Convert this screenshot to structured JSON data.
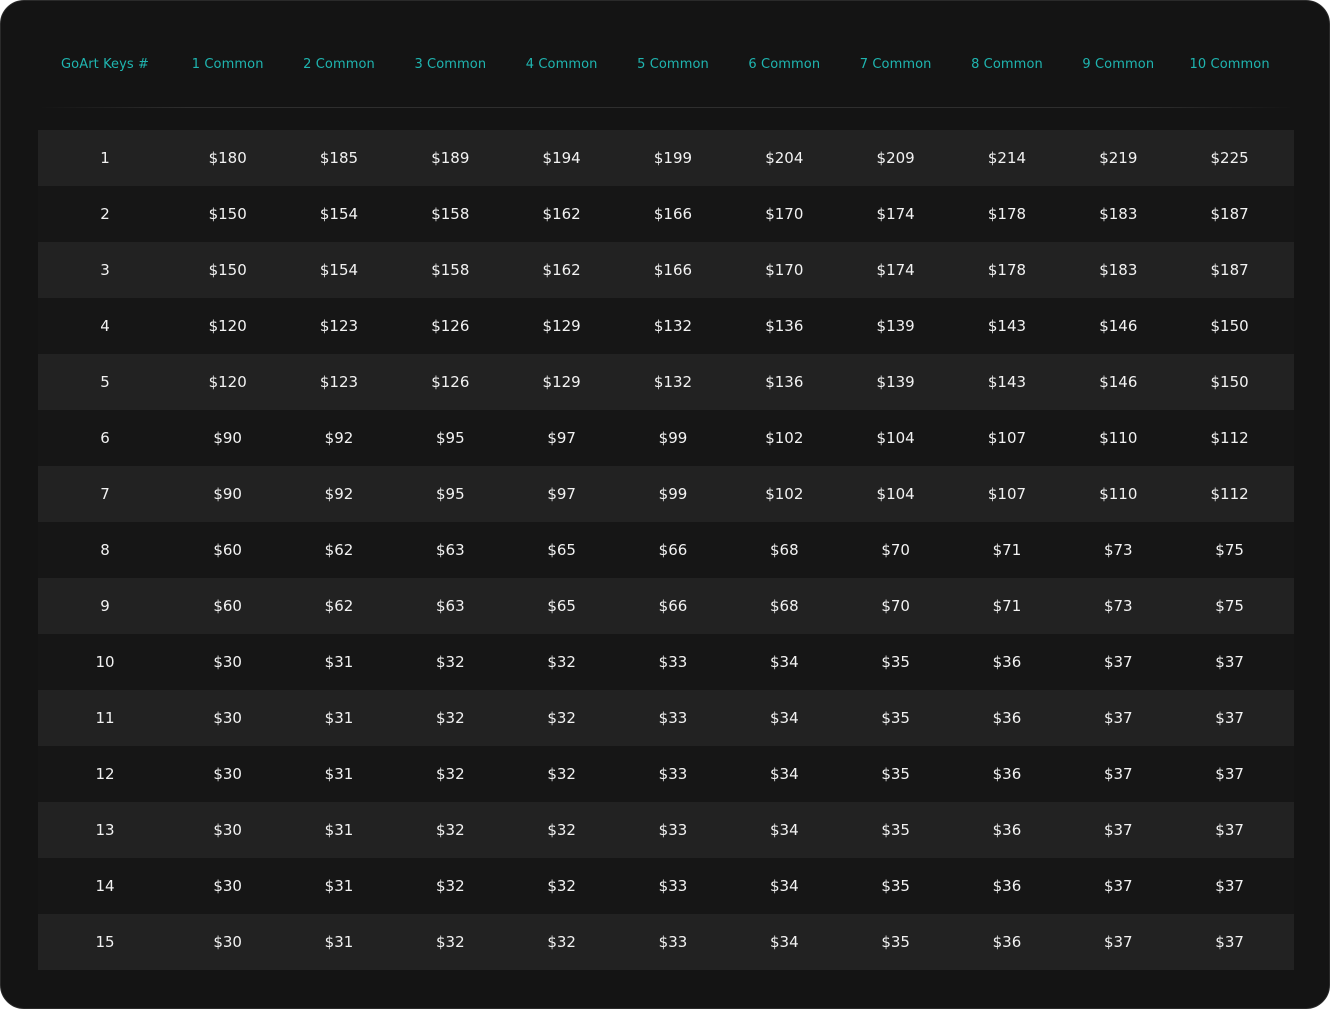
{
  "table": {
    "headers": [
      "GoArt Keys #",
      "1 Common",
      "2 Common",
      "3 Common",
      "4 Common",
      "5 Common",
      "6 Common",
      "7 Common",
      "8 Common",
      "9 Common",
      "10 Common"
    ],
    "rows": [
      [
        "1",
        "$180",
        "$185",
        "$189",
        "$194",
        "$199",
        "$204",
        "$209",
        "$214",
        "$219",
        "$225"
      ],
      [
        "2",
        "$150",
        "$154",
        "$158",
        "$162",
        "$166",
        "$170",
        "$174",
        "$178",
        "$183",
        "$187"
      ],
      [
        "3",
        "$150",
        "$154",
        "$158",
        "$162",
        "$166",
        "$170",
        "$174",
        "$178",
        "$183",
        "$187"
      ],
      [
        "4",
        "$120",
        "$123",
        "$126",
        "$129",
        "$132",
        "$136",
        "$139",
        "$143",
        "$146",
        "$150"
      ],
      [
        "5",
        "$120",
        "$123",
        "$126",
        "$129",
        "$132",
        "$136",
        "$139",
        "$143",
        "$146",
        "$150"
      ],
      [
        "6",
        "$90",
        "$92",
        "$95",
        "$97",
        "$99",
        "$102",
        "$104",
        "$107",
        "$110",
        "$112"
      ],
      [
        "7",
        "$90",
        "$92",
        "$95",
        "$97",
        "$99",
        "$102",
        "$104",
        "$107",
        "$110",
        "$112"
      ],
      [
        "8",
        "$60",
        "$62",
        "$63",
        "$65",
        "$66",
        "$68",
        "$70",
        "$71",
        "$73",
        "$75"
      ],
      [
        "9",
        "$60",
        "$62",
        "$63",
        "$65",
        "$66",
        "$68",
        "$70",
        "$71",
        "$73",
        "$75"
      ],
      [
        "10",
        "$30",
        "$31",
        "$32",
        "$32",
        "$33",
        "$34",
        "$35",
        "$36",
        "$37",
        "$37"
      ],
      [
        "11",
        "$30",
        "$31",
        "$32",
        "$32",
        "$33",
        "$34",
        "$35",
        "$36",
        "$37",
        "$37"
      ],
      [
        "12",
        "$30",
        "$31",
        "$32",
        "$32",
        "$33",
        "$34",
        "$35",
        "$36",
        "$37",
        "$37"
      ],
      [
        "13",
        "$30",
        "$31",
        "$32",
        "$32",
        "$33",
        "$34",
        "$35",
        "$36",
        "$37",
        "$37"
      ],
      [
        "14",
        "$30",
        "$31",
        "$32",
        "$32",
        "$33",
        "$34",
        "$35",
        "$36",
        "$37",
        "$37"
      ],
      [
        "15",
        "$30",
        "$31",
        "$32",
        "$32",
        "$33",
        "$34",
        "$35",
        "$36",
        "$37",
        "$37"
      ]
    ]
  },
  "colors": {
    "background": "#141414",
    "row_alt": "#222222",
    "header_text": "#1fb5b0",
    "cell_text": "#f2f2f2"
  }
}
